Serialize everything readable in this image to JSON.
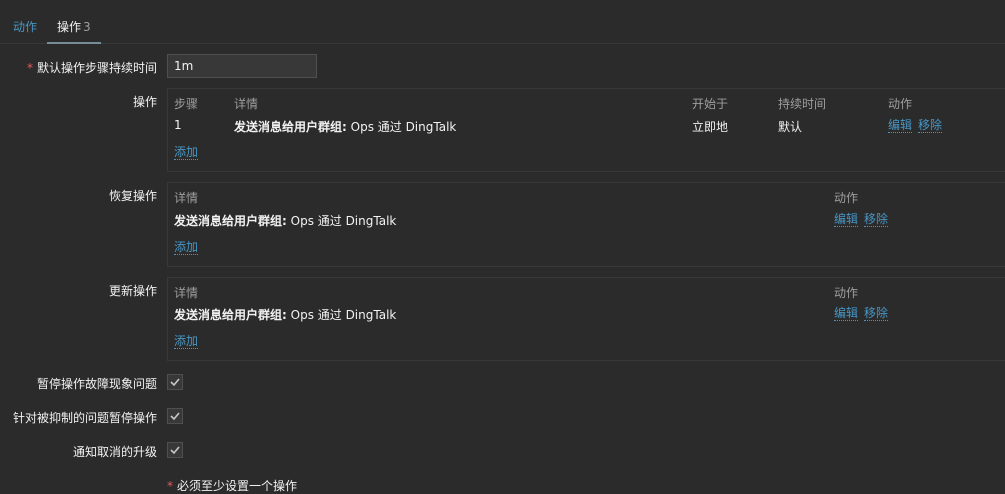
{
  "tabs": [
    {
      "label": "动作"
    },
    {
      "label": "操作",
      "count": "3"
    }
  ],
  "default_step_duration": {
    "label": "默认操作步骤持续时间",
    "value": "1m"
  },
  "operations": {
    "label": "操作",
    "headers": [
      "步骤",
      "详情",
      "开始于",
      "持续时间",
      "动作"
    ],
    "rows": [
      {
        "step": "1",
        "details_bold": "发送消息给用户群组:",
        "details_rest": " Ops 通过 DingTalk",
        "start": "立即地",
        "duration": "默认",
        "edit": "编辑",
        "remove": "移除"
      }
    ],
    "add": "添加"
  },
  "recovery_operations": {
    "label": "恢复操作",
    "headers": [
      "详情",
      "动作"
    ],
    "rows": [
      {
        "details_bold": "发送消息给用户群组:",
        "details_rest": " Ops 通过 DingTalk",
        "edit": "编辑",
        "remove": "移除"
      }
    ],
    "add": "添加"
  },
  "update_operations": {
    "label": "更新操作",
    "headers": [
      "详情",
      "动作"
    ],
    "rows": [
      {
        "details_bold": "发送消息给用户群组:",
        "details_rest": " Ops 通过 DingTalk",
        "edit": "编辑",
        "remove": "移除"
      }
    ],
    "add": "添加"
  },
  "checkboxes": [
    {
      "label": "暂停操作故障现象问题",
      "checked": true
    },
    {
      "label": "针对被抑制的问题暂停操作",
      "checked": true
    },
    {
      "label": "通知取消的升级",
      "checked": true
    }
  ],
  "footer_note": "必须至少设置一个操作"
}
